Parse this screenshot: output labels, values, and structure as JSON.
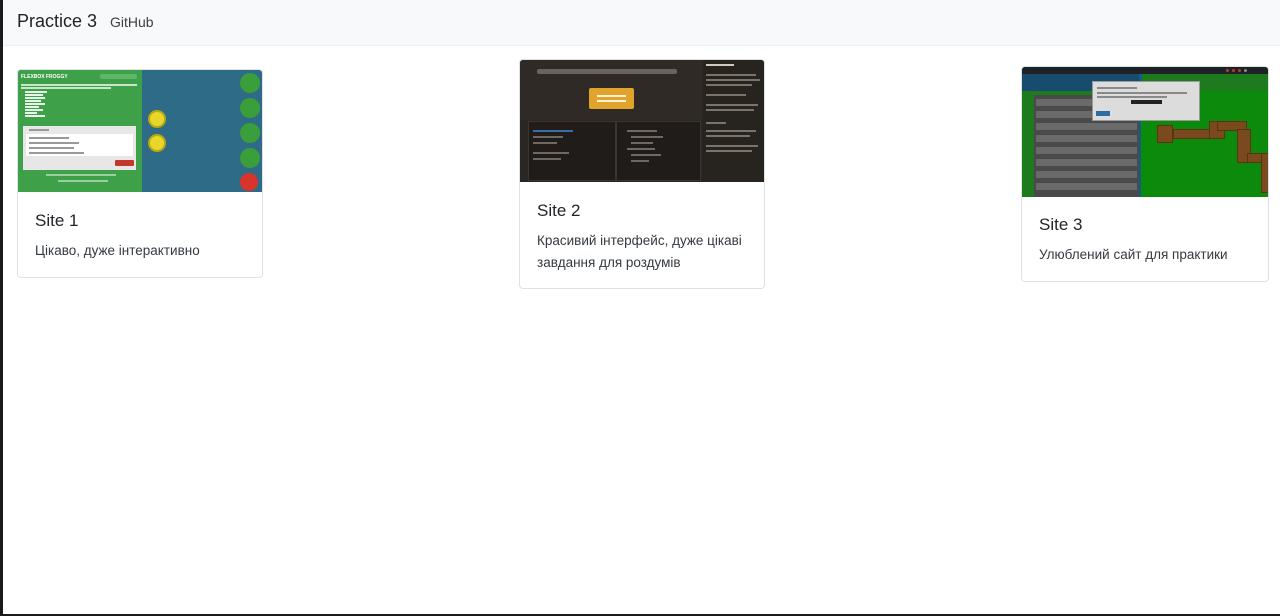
{
  "navbar": {
    "brand": "Practice 3",
    "links": [
      "GitHub"
    ]
  },
  "cards": [
    {
      "title": "Site 1",
      "text": "Цікаво, дуже інтерактивно"
    },
    {
      "title": "Site 2",
      "text": "Красивий інтерфейс, дуже цікаві завдання для роздумів"
    },
    {
      "title": "Site 3",
      "text": "Улюблений сайт для практики"
    }
  ],
  "colors": {
    "navbar_bg": "#f8f9fa",
    "card_border": "#dfe1e4",
    "text": "#212529"
  }
}
